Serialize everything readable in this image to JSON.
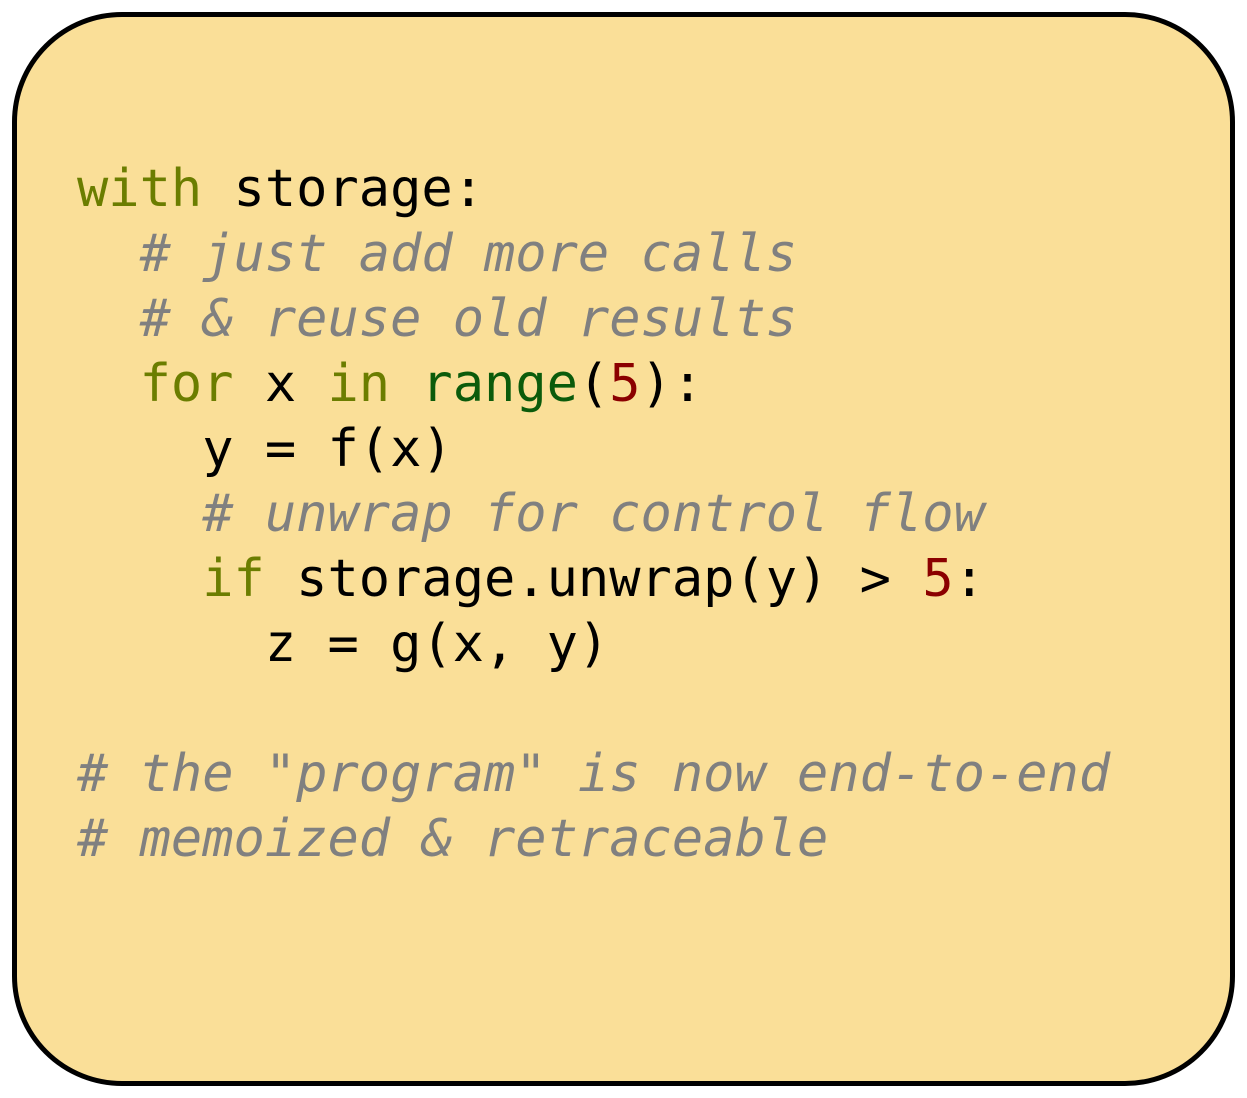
{
  "code": {
    "lines": [
      {
        "indent": 0,
        "parts": [
          {
            "t": "with",
            "c": "kw"
          },
          {
            "t": " storage:",
            "c": "txt"
          }
        ]
      },
      {
        "indent": 1,
        "parts": [
          {
            "t": "# just add more calls",
            "c": "cm"
          }
        ]
      },
      {
        "indent": 1,
        "parts": [
          {
            "t": "# & reuse old results",
            "c": "cm"
          }
        ]
      },
      {
        "indent": 1,
        "parts": [
          {
            "t": "for",
            "c": "kw"
          },
          {
            "t": " x ",
            "c": "txt"
          },
          {
            "t": "in",
            "c": "kw"
          },
          {
            "t": " ",
            "c": "txt"
          },
          {
            "t": "range",
            "c": "fn"
          },
          {
            "t": "(",
            "c": "txt"
          },
          {
            "t": "5",
            "c": "num"
          },
          {
            "t": "):",
            "c": "txt"
          }
        ]
      },
      {
        "indent": 2,
        "parts": [
          {
            "t": "y = f(x)",
            "c": "txt"
          }
        ]
      },
      {
        "indent": 2,
        "parts": [
          {
            "t": "# unwrap for control flow",
            "c": "cm"
          }
        ]
      },
      {
        "indent": 2,
        "parts": [
          {
            "t": "if",
            "c": "kw"
          },
          {
            "t": " storage.unwrap(y) > ",
            "c": "txt"
          },
          {
            "t": "5",
            "c": "num"
          },
          {
            "t": ":",
            "c": "txt"
          }
        ]
      },
      {
        "indent": 3,
        "parts": [
          {
            "t": "z = g(x, y)",
            "c": "txt"
          }
        ]
      },
      {
        "indent": 0,
        "parts": []
      },
      {
        "indent": 0,
        "parts": [
          {
            "t": "# the \"program\" is now end-to-end",
            "c": "cm"
          }
        ]
      },
      {
        "indent": 0,
        "parts": [
          {
            "t": "# memoized & retraceable",
            "c": "cm"
          }
        ]
      }
    ]
  }
}
